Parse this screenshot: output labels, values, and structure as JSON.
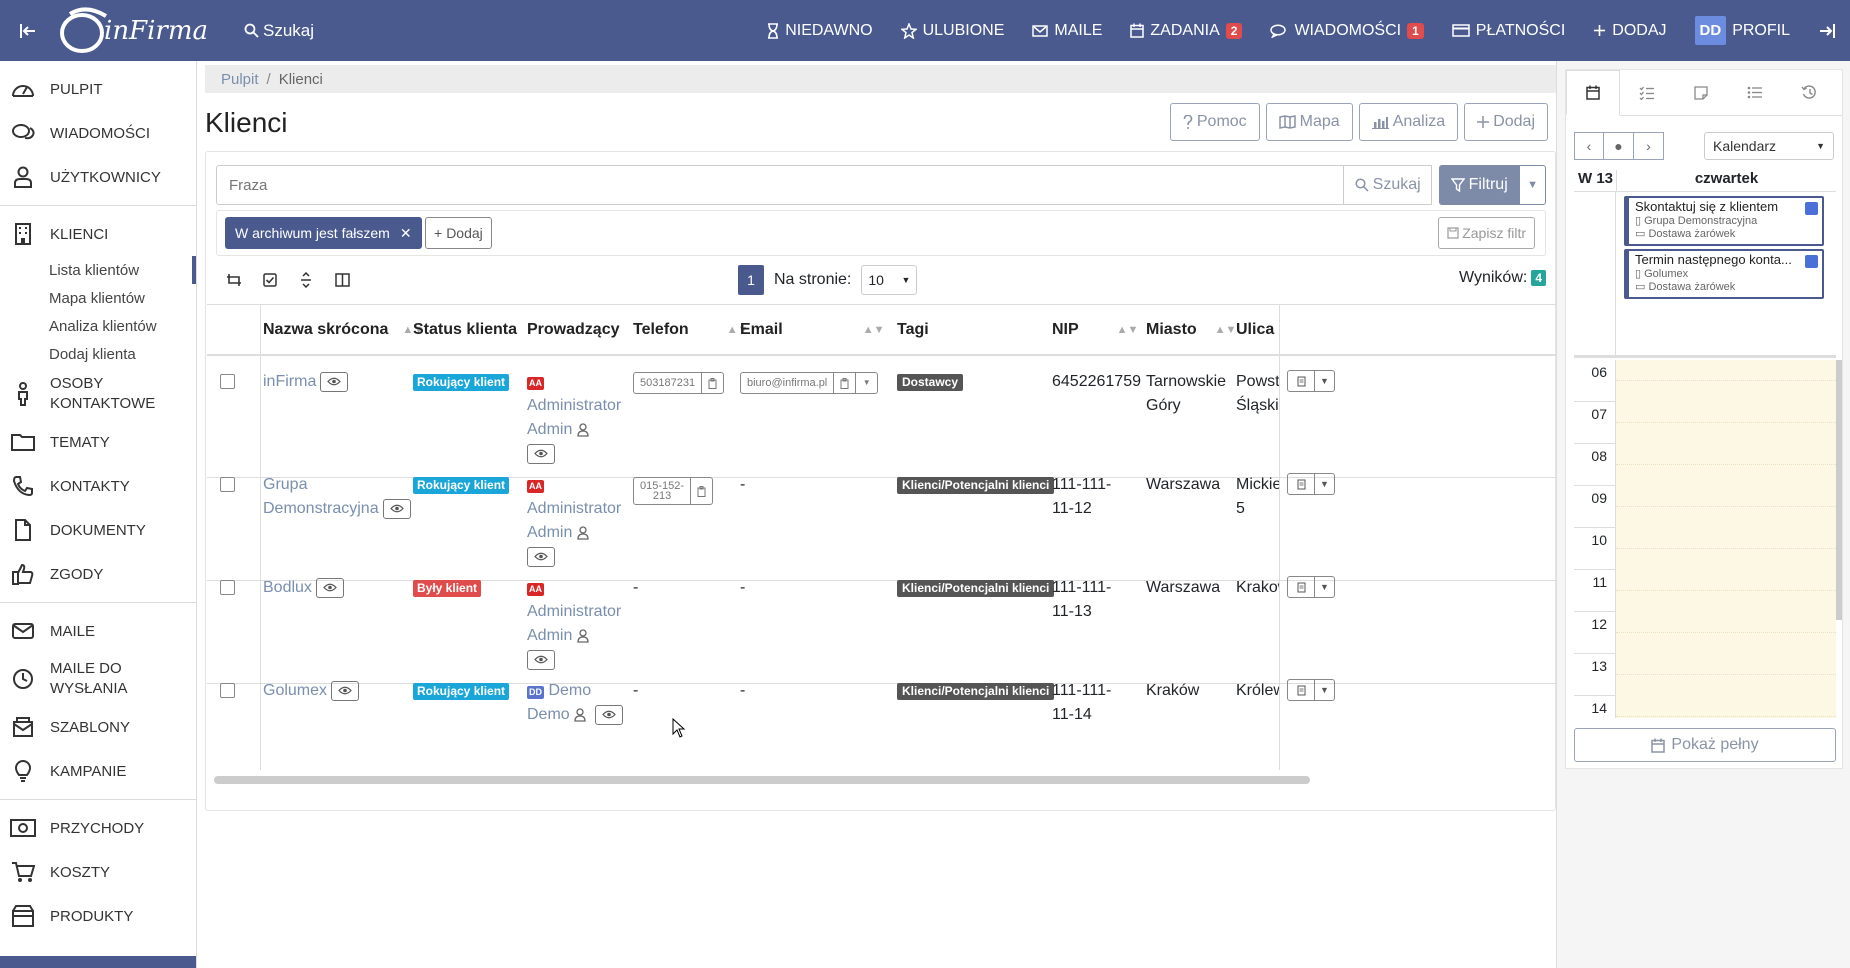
{
  "topbar": {
    "search_label": "Szukaj",
    "logo_text": "inFirma",
    "nav": [
      {
        "label": "NIEDAWNO",
        "icon": "hourglass-icon"
      },
      {
        "label": "ULUBIONE",
        "icon": "star-icon"
      },
      {
        "label": "MAILE",
        "icon": "envelope-icon"
      },
      {
        "label": "ZADANIA",
        "icon": "calendar-icon",
        "badge": "2"
      },
      {
        "label": "WIADOMOŚCI",
        "icon": "chat-icon",
        "badge": "1"
      },
      {
        "label": "PŁATNOŚCI",
        "icon": "card-icon"
      },
      {
        "label": "DODAJ",
        "icon": "plus-icon"
      },
      {
        "label": "PROFIL",
        "avatar": "DD"
      }
    ]
  },
  "sidebar": {
    "items": [
      {
        "label": "PULPIT",
        "icon": "dashboard-icon"
      },
      {
        "label": "WIADOMOŚCI",
        "icon": "chat-icon"
      },
      {
        "label": "UŻYTKOWNICY",
        "icon": "user-icon"
      },
      {
        "label": "KLIENCI",
        "icon": "building-icon"
      },
      {
        "label": "OSOBY KONTAKTOWE",
        "icon": "person-icon"
      },
      {
        "label": "TEMATY",
        "icon": "folder-icon"
      },
      {
        "label": "KONTAKTY",
        "icon": "phone-icon"
      },
      {
        "label": "DOKUMENTY",
        "icon": "document-icon"
      },
      {
        "label": "ZGODY",
        "icon": "thumbs-up-icon"
      },
      {
        "label": "MAILE",
        "icon": "envelope-icon"
      },
      {
        "label": "MAILE DO WYSŁANIA",
        "icon": "clock-icon"
      },
      {
        "label": "SZABLONY",
        "icon": "template-icon"
      },
      {
        "label": "KAMPANIE",
        "icon": "bulb-icon"
      },
      {
        "label": "PRZYCHODY",
        "icon": "money-icon"
      },
      {
        "label": "KOSZTY",
        "icon": "cart-icon"
      },
      {
        "label": "PRODUKTY",
        "icon": "box-icon"
      }
    ],
    "sub_items": [
      "Lista klientów",
      "Mapa klientów",
      "Analiza klientów",
      "Dodaj klienta"
    ]
  },
  "breadcrumb": {
    "home": "Pulpit",
    "current": "Klienci"
  },
  "page": {
    "title": "Klienci",
    "actions": {
      "help": "Pomoc",
      "map": "Mapa",
      "analysis": "Analiza",
      "add": "Dodaj"
    }
  },
  "search": {
    "placeholder": "Fraza",
    "search_label": "Szukaj",
    "filter_label": "Filtruj"
  },
  "filters": {
    "active_chip": "W archiwum jest fałszem",
    "add_label": "Dodaj",
    "save_label": "Zapisz filtr"
  },
  "pager": {
    "current_page": "1",
    "per_page_label": "Na stronie:",
    "per_page": "10",
    "results_label": "Wyników:",
    "results_count": "4"
  },
  "table": {
    "headers": [
      "Nazwa skrócona",
      "Status klienta",
      "Prowadzący",
      "Telefon",
      "Email",
      "Tagi",
      "NIP",
      "Miasto",
      "Ulica"
    ],
    "rows": [
      {
        "name": "inFirma",
        "status": "Rokujący klient",
        "status_color": "#1aa6d9",
        "owner_initials": "AA",
        "owner_first": "Administrator",
        "owner_last": "Admin",
        "phone": "503187231",
        "email": "biuro@infirma.pl",
        "tag": "Dostawcy",
        "nip_line1": "6452261759",
        "nip_line2": "",
        "city_line1": "Tarnowskie",
        "city_line2": "Góry",
        "street_line1": "Powsta",
        "street_line2": "Śląskich"
      },
      {
        "name_line1": "Grupa",
        "name_line2": "Demonstracyjna",
        "status": "Rokujący klient",
        "status_color": "#1aa6d9",
        "owner_initials": "AA",
        "owner_first": "Administrator",
        "owner_last": "Admin",
        "phone_line1": "015-152-",
        "phone_line2": "213",
        "email": "-",
        "tag": "Klienci/Potencjalni klienci",
        "nip_line1": "111-111-",
        "nip_line2": "11-12",
        "city_line1": "Warszawa",
        "city_line2": "",
        "street_line1": "Mickiew",
        "street_line2": "5"
      },
      {
        "name": "Bodlux",
        "status": "Były klient",
        "status_color": "#e04b4b",
        "owner_initials": "AA",
        "owner_first": "Administrator",
        "owner_last": "Admin",
        "phone": "-",
        "email": "-",
        "tag": "Klienci/Potencjalni klienci",
        "nip_line1": "111-111-",
        "nip_line2": "11-13",
        "city_line1": "Warszawa",
        "city_line2": "",
        "street_line1": "Krakow",
        "street_line2": ""
      },
      {
        "name": "Golumex",
        "status": "Rokujący klient",
        "status_color": "#1aa6d9",
        "owner_initials": "DD",
        "owner_first": "Demo",
        "owner_last": "Demo",
        "phone": "-",
        "email": "-",
        "tag": "Klienci/Potencjalni klienci",
        "nip_line1": "111-111-",
        "nip_line2": "11-14",
        "city_line1": "Kraków",
        "city_line2": "",
        "street_line1": "Królews",
        "street_line2": ""
      }
    ]
  },
  "calendar": {
    "view_select": "Kalendarz",
    "week_label": "W 13",
    "day_label": "czwartek",
    "events": [
      {
        "title": "Skontaktuj się z klientem",
        "client": "Grupa Demonstracyjna",
        "topic": "Dostawa żarówek"
      },
      {
        "title": "Termin następnego konta...",
        "client": "Golumex",
        "topic": "Dostawa żarówek"
      }
    ],
    "hours": [
      "06",
      "07",
      "08",
      "09",
      "10",
      "11",
      "12",
      "13",
      "14"
    ],
    "show_full_label": "Pokaż pełny"
  }
}
